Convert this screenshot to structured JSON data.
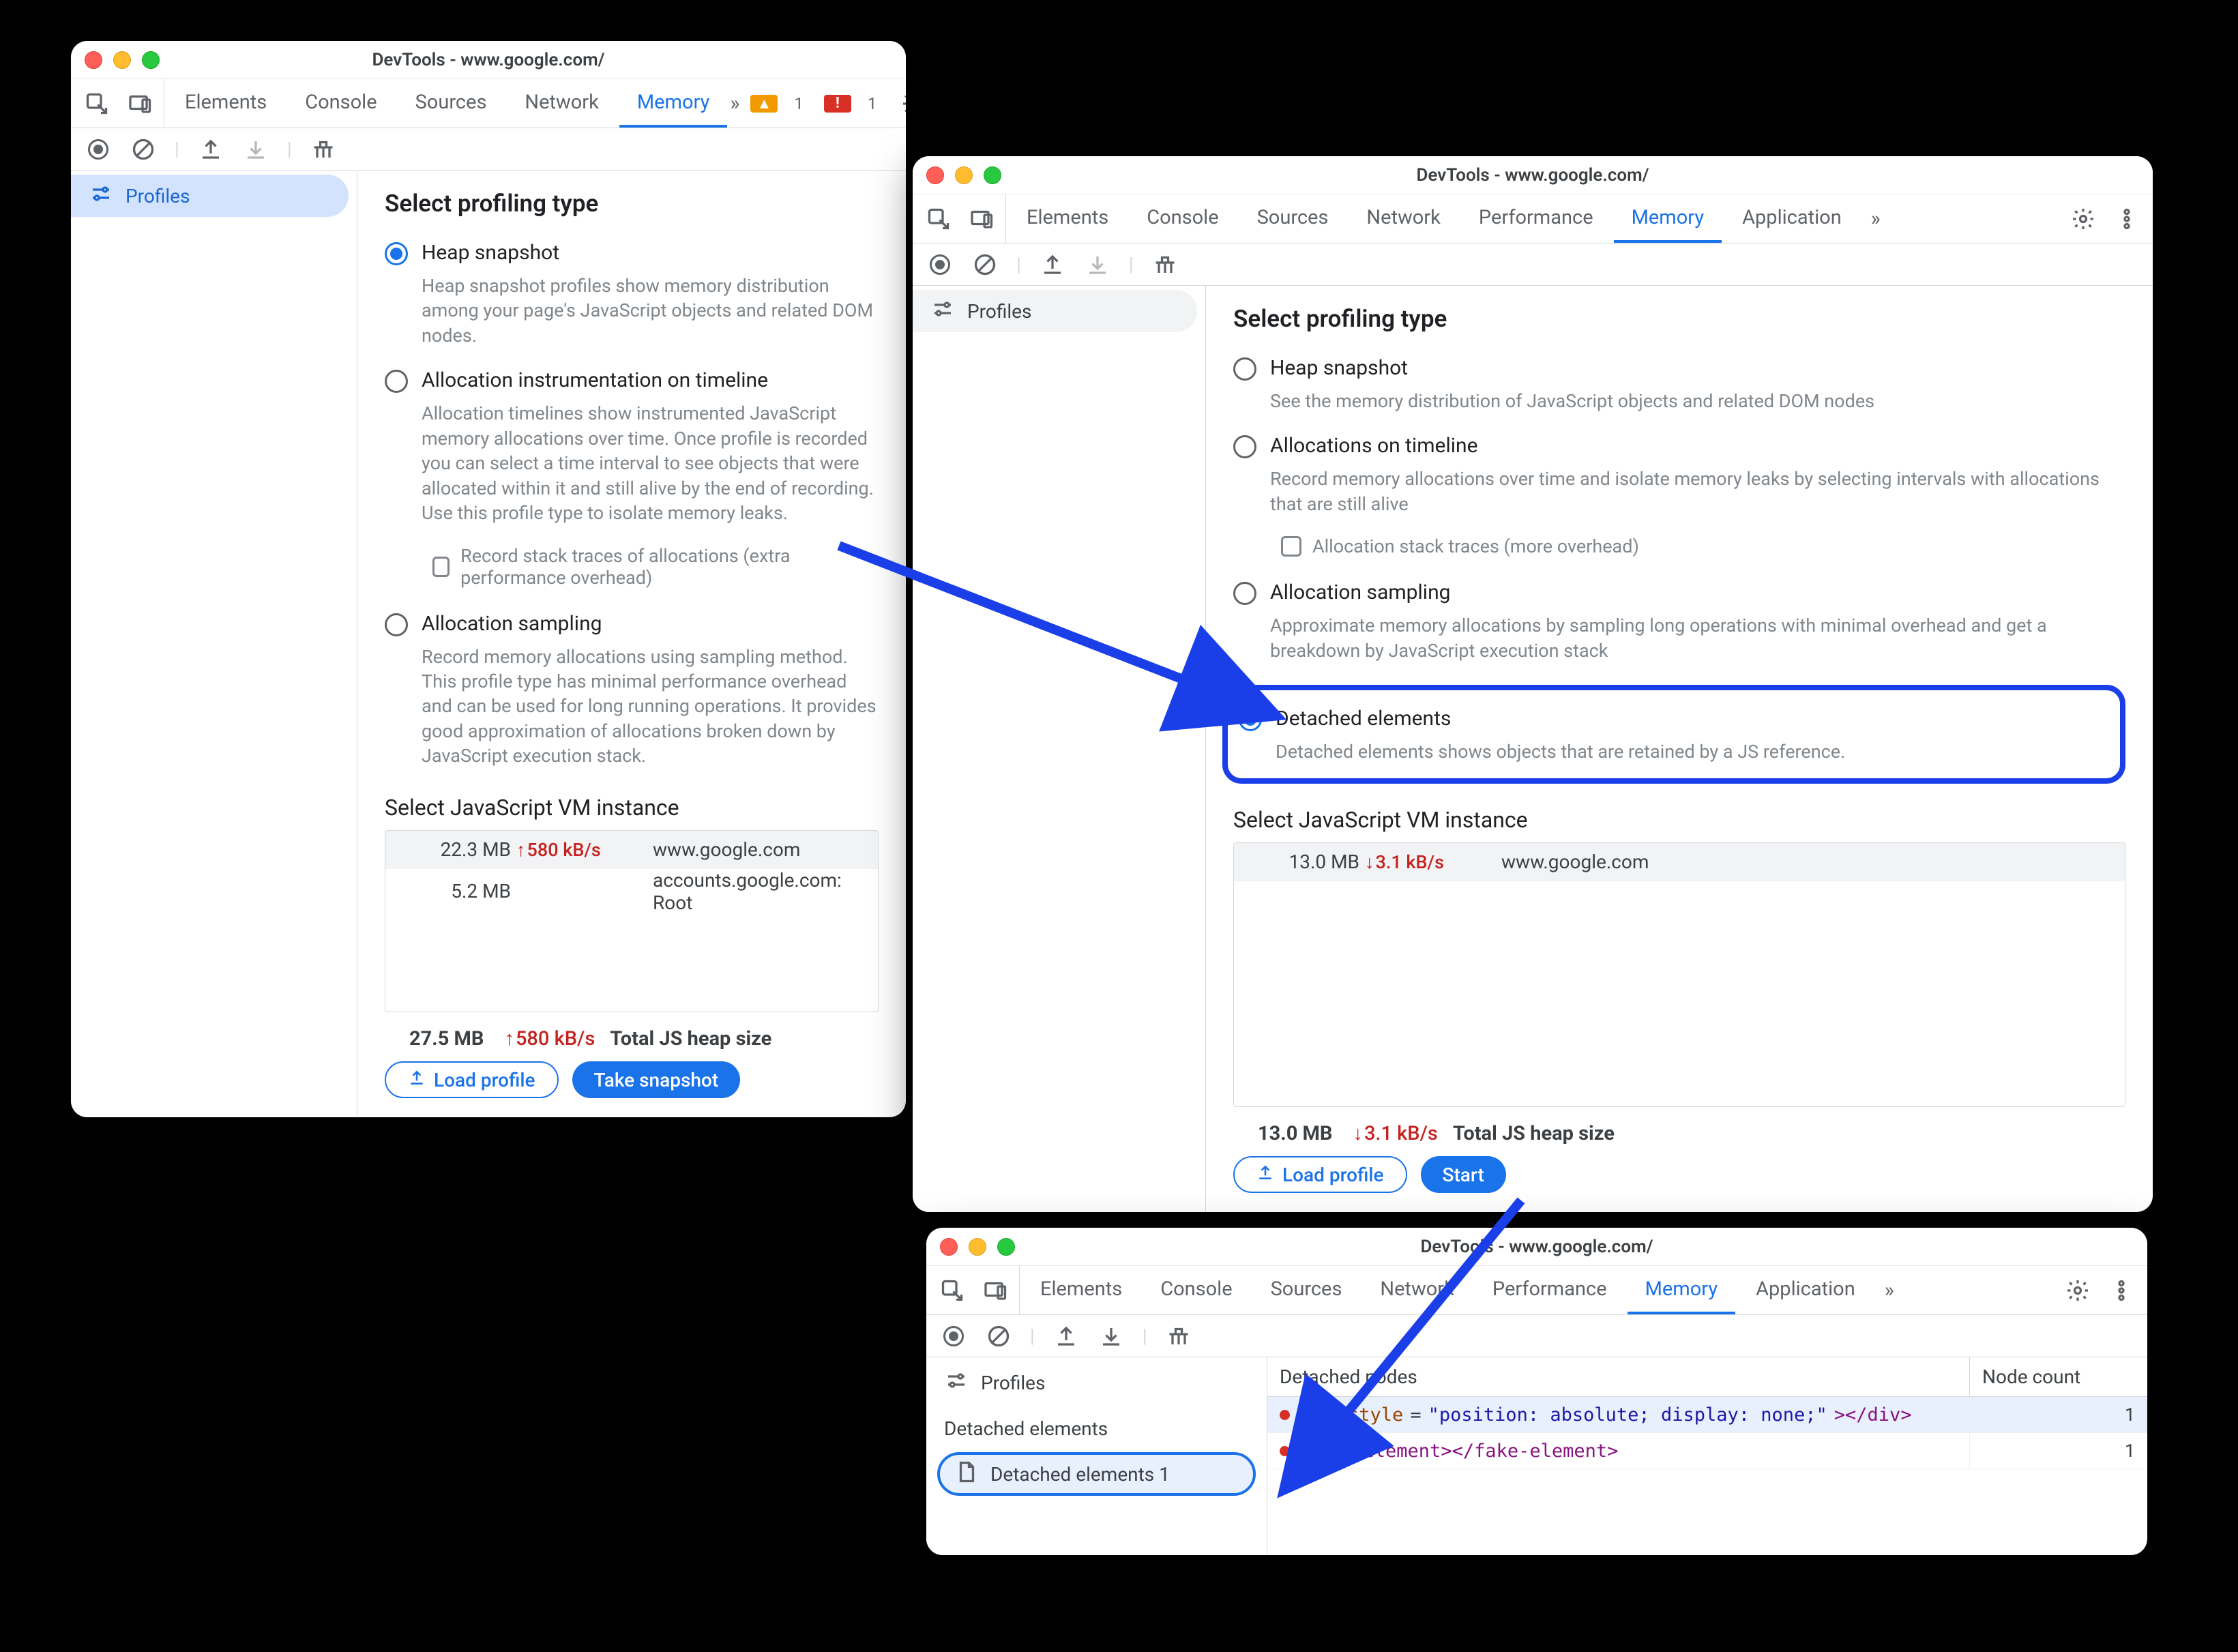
{
  "windows": {
    "w1": {
      "title": "DevTools - www.google.com/",
      "tabs": [
        "Elements",
        "Console",
        "Sources",
        "Network",
        "Memory"
      ],
      "active_tab": "Memory",
      "badges": {
        "warn": "1",
        "err": "1"
      },
      "sidebar": {
        "profiles": "Profiles"
      },
      "heading": "Select profiling type",
      "opts": {
        "heap": {
          "label": "Heap snapshot",
          "desc": "Heap snapshot profiles show memory distribution among your page's JavaScript objects and related DOM nodes."
        },
        "timeline": {
          "label": "Allocation instrumentation on timeline",
          "desc": "Allocation timelines show instrumented JavaScript memory allocations over time. Once profile is recorded you can select a time interval to see objects that were allocated within it and still alive by the end of recording. Use this profile type to isolate memory leaks.",
          "checkbox": "Record stack traces of allocations (extra performance overhead)"
        },
        "sampling": {
          "label": "Allocation sampling",
          "desc": "Record memory allocations using sampling method. This profile type has minimal performance overhead and can be used for long running operations. It provides good approximation of allocations broken down by JavaScript execution stack."
        }
      },
      "vm_heading": "Select JavaScript VM instance",
      "vm_rows": [
        {
          "size": "22.3 MB",
          "rate": "580 kB/s",
          "host": "www.google.com"
        },
        {
          "size": "5.2 MB",
          "rate": "",
          "host": "accounts.google.com: Root"
        }
      ],
      "footer": {
        "total_size": "27.5 MB",
        "total_rate": "580 kB/s",
        "total_label": "Total JS heap size",
        "load": "Load profile",
        "action": "Take snapshot"
      }
    },
    "w2": {
      "title": "DevTools - www.google.com/",
      "tabs": [
        "Elements",
        "Console",
        "Sources",
        "Network",
        "Performance",
        "Memory",
        "Application"
      ],
      "active_tab": "Memory",
      "sidebar": {
        "profiles": "Profiles"
      },
      "heading": "Select profiling type",
      "opts": {
        "heap": {
          "label": "Heap snapshot",
          "desc": "See the memory distribution of JavaScript objects and related DOM nodes"
        },
        "timeline": {
          "label": "Allocations on timeline",
          "desc": "Record memory allocations over time and isolate memory leaks by selecting intervals with allocations that are still alive",
          "checkbox": "Allocation stack traces (more overhead)"
        },
        "sampling": {
          "label": "Allocation sampling",
          "desc": "Approximate memory allocations by sampling long operations with minimal overhead and get a breakdown by JavaScript execution stack"
        },
        "detached": {
          "label": "Detached elements",
          "desc": "Detached elements shows objects that are retained by a JS reference."
        }
      },
      "vm_heading": "Select JavaScript VM instance",
      "vm_rows": [
        {
          "size": "13.0 MB",
          "rate": "3.1 kB/s",
          "host": "www.google.com"
        }
      ],
      "footer": {
        "total_size": "13.0 MB",
        "total_rate": "3.1 kB/s",
        "total_label": "Total JS heap size",
        "load": "Load profile",
        "action": "Start"
      }
    },
    "w3": {
      "title": "DevTools - www.google.com/",
      "tabs": [
        "Elements",
        "Console",
        "Sources",
        "Network",
        "Performance",
        "Memory",
        "Application"
      ],
      "active_tab": "Memory",
      "sidebar": {
        "profiles": "Profiles",
        "category": "Detached elements",
        "item": "Detached elements 1"
      },
      "table": {
        "col1": "Detached nodes",
        "col2": "Node count",
        "rows": [
          {
            "html": "<div style=\"position: absolute; display: none;\"></div>",
            "count": "1"
          },
          {
            "html": "<fake-element></fake-element>",
            "count": "1"
          }
        ]
      }
    }
  }
}
